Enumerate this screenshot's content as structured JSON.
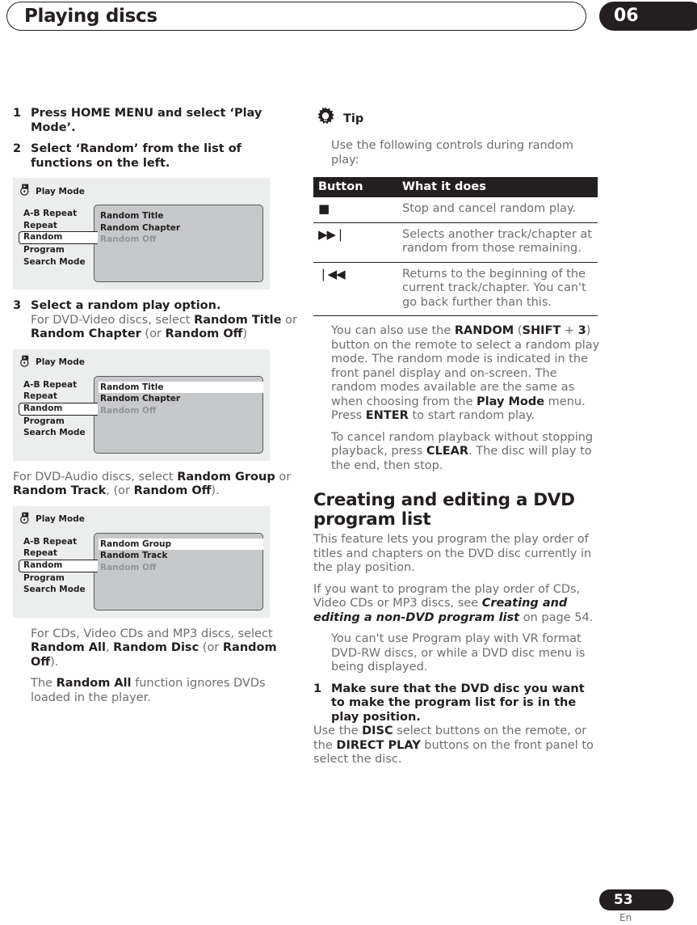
{
  "header": {
    "title": "Playing discs",
    "chapter": "06"
  },
  "footer": {
    "page": "53",
    "language": "En"
  },
  "left_column": {
    "step1_num": "1",
    "step1_text": "Press HOME MENU and select ‘Play Mode’.",
    "step2_num": "2",
    "step2_text": "Select ‘Random’ from the list of functions on the left.",
    "osd1": {
      "title": "Play Mode",
      "icon": "play-mode-disc-icon",
      "menu": [
        "A-B Repeat",
        "Repeat",
        "Random",
        "Program",
        "Search Mode"
      ],
      "selected_menu": "Random",
      "options": [
        "Random Title",
        "Random Chapter",
        "Random Off"
      ],
      "highlighted_option": "",
      "disabled_option": "Random Off"
    },
    "step3_num": "3",
    "step3_title": "Select a random play option.",
    "step3_body_pre": "For DVD-Video discs, select ",
    "step3_b1": "Random Title",
    "step3_mid1": " or ",
    "step3_b2": "Random Chapter",
    "step3_mid2": " (or ",
    "step3_b3": "Random Off",
    "step3_post": ")",
    "osd2": {
      "title": "Play Mode",
      "icon": "play-mode-disc-icon",
      "menu": [
        "A-B Repeat",
        "Repeat",
        "Random",
        "Program",
        "Search Mode"
      ],
      "selected_menu": "Random",
      "options": [
        "Random Title",
        "Random Chapter",
        "Random Off"
      ],
      "highlighted_option": "Random Title",
      "disabled_option": "Random Off"
    },
    "para_audio_pre": "For DVD-Audio discs, select ",
    "para_audio_b1": "Random Group",
    "para_audio_mid1": " or ",
    "para_audio_b2": "Random Track",
    "para_audio_mid2": ", (or ",
    "para_audio_b3": "Random Off",
    "para_audio_post": ").",
    "osd3": {
      "title": "Play Mode",
      "icon": "play-mode-disc-icon",
      "menu": [
        "A-B Repeat",
        "Repeat",
        "Random",
        "Program",
        "Search Mode"
      ],
      "selected_menu": "Random",
      "options": [
        "Random Group",
        "Random Track",
        "Random Off"
      ],
      "highlighted_option": "Random Group",
      "disabled_option": "Random Off"
    },
    "para_cd_pre": "For CDs, Video CDs and MP3 discs, select ",
    "para_cd_b1": "Random All",
    "para_cd_mid1": ", ",
    "para_cd_b2": "Random Disc",
    "para_cd_mid2": " (or ",
    "para_cd_b3": "Random Off",
    "para_cd_post": ").",
    "para_ignore_pre": "The ",
    "para_ignore_b": "Random All",
    "para_ignore_post": " function ignores DVDs loaded in the player."
  },
  "right_column": {
    "tip": {
      "icon": "tip-lightbulb-icon",
      "label": "Tip",
      "body": "Use the following controls during random play:"
    },
    "table": {
      "headers": [
        "Button",
        "What it does"
      ],
      "rows": [
        {
          "button_icon": "stop-icon",
          "button_glyph": "■",
          "description": "Stop and cancel random play."
        },
        {
          "button_icon": "next-track-icon",
          "button_glyph": "▶▶❘",
          "description": "Selects another track/chapter at random from those remaining."
        },
        {
          "button_icon": "previous-track-icon",
          "button_glyph": "❘◀◀",
          "description": "Returns to the beginning of the current track/chapter. You can't go back further than this."
        }
      ]
    },
    "para_random_pre": "You can also use the ",
    "para_random_b1": "RANDOM",
    "para_random_mid1": " (",
    "para_random_b2": "SHIFT",
    "para_random_mid2": " + ",
    "para_random_b3": "3",
    "para_random_mid3": ") button on the remote to select a random play mode. The random mode is indicated in the front panel display and on-screen. The random modes available are the same as when choosing from the ",
    "para_random_b4": "Play Mode",
    "para_random_mid4": " menu. Press ",
    "para_random_b5": "ENTER",
    "para_random_post": " to start random play.",
    "para_cancel_pre": "To cancel random playback without stopping playback, press ",
    "para_cancel_b": "CLEAR",
    "para_cancel_post": ". The disc will play to the end, then stop.",
    "section_title": "Creating and editing a DVD program list",
    "para_feature": "This feature lets you program the play order of titles and chapters on the DVD disc currently in the play position.",
    "para_xref_pre": "If you want to program the play order of CDs, Video CDs or MP3 discs, see ",
    "para_xref_i": "Creating and editing a non-DVD program list",
    "para_xref_post": " on page 54.",
    "note_text": "You can't use Program play with VR format DVD-RW discs, or while a DVD disc menu is being displayed.",
    "step1_num": "1",
    "step1_text": "Make sure that the DVD disc you want to make the program list for is in the play position.",
    "step1_sub_pre": "Use the ",
    "step1_sub_b1": "DISC",
    "step1_sub_mid": " select buttons on the remote, or the ",
    "step1_sub_b2": "DIRECT PLAY",
    "step1_sub_post": " buttons on the front panel to select the disc."
  }
}
